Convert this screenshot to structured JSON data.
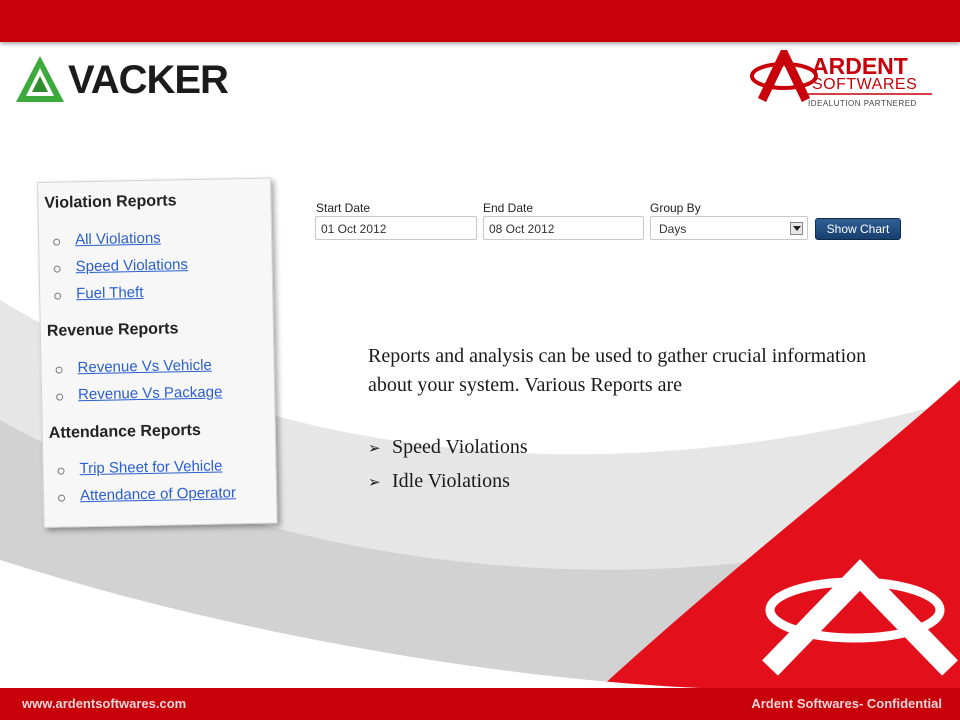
{
  "brand": {
    "vacker_name": "VACKER",
    "ardent_name": "ARDENT",
    "ardent_sub": "SOFTWARES",
    "ardent_tagline": "IDEALUTION PARTNERED"
  },
  "sidebar": {
    "sections": [
      {
        "heading": "Violation Reports",
        "items": [
          "All Violations",
          "Speed Violations",
          "Fuel Theft"
        ]
      },
      {
        "heading": "Revenue Reports",
        "items": [
          "Revenue Vs Vehicle",
          "Revenue Vs Package"
        ]
      },
      {
        "heading": "Attendance Reports",
        "items": [
          "Trip Sheet for Vehicle",
          "Attendance of Operator"
        ]
      }
    ]
  },
  "filters": {
    "start_label": "Start Date",
    "start_value": "01 Oct 2012",
    "end_label": "End Date",
    "end_value": "08 Oct 2012",
    "group_label": "Group By",
    "group_value": "Days",
    "show_chart_label": "Show Chart"
  },
  "content": {
    "description": "Reports and analysis can be used to gather crucial information about your system. Various Reports are",
    "bullets": [
      "Speed Violations",
      "Idle Violations"
    ]
  },
  "footer": {
    "website": "www.ardentsoftwares.com",
    "confidential": "Ardent Softwares- Confidential"
  },
  "colors": {
    "brand_red": "#c8000a",
    "link_blue": "#2a5fcf",
    "button_blue": "#1f4c80",
    "vacker_green": "#3caa3c"
  }
}
